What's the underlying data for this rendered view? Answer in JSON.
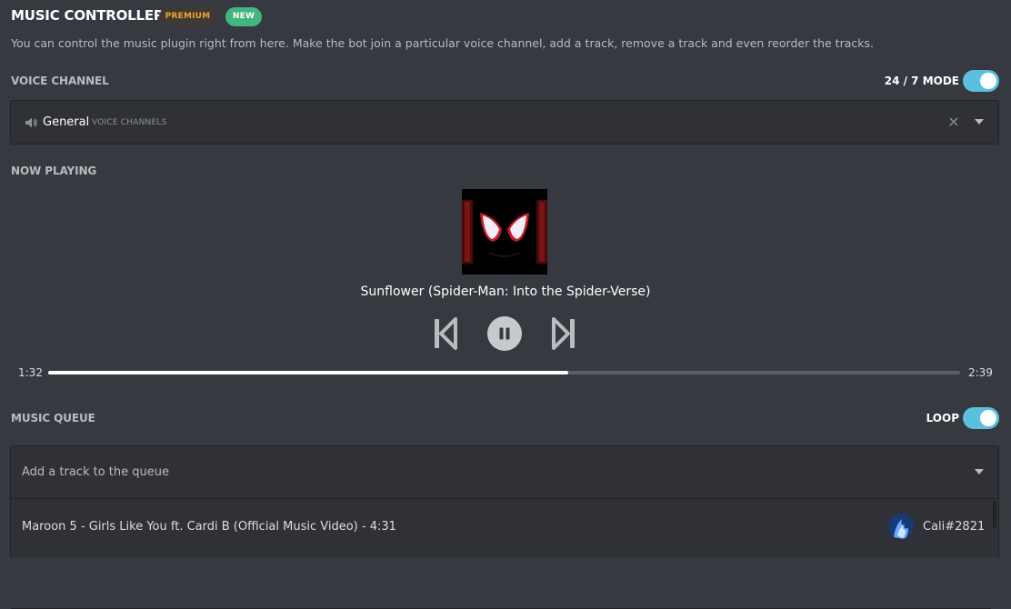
{
  "header": {
    "title": "MUSIC CONTROLLER",
    "badge_premium": "PREMIUM",
    "badge_new": "NEW",
    "description": "You can control the music plugin right from here. Make the bot join a particular voice channel, add a track, remove a track and even reorder the tracks."
  },
  "voice_channel": {
    "label": "VOICE CHANNEL",
    "mode_label": "24 / 7 MODE",
    "mode_enabled": true,
    "selected_name": "General",
    "selected_category": "VOICE CHANNELS"
  },
  "now_playing": {
    "label": "NOW PLAYING",
    "title": "Sunflower (Spider-Man: Into the Spider-Verse)",
    "elapsed": "1:32",
    "duration": "2:39",
    "progress_fraction": 0.57,
    "state": "playing"
  },
  "queue": {
    "label": "MUSIC QUEUE",
    "loop_label": "LOOP",
    "loop_enabled": true,
    "placeholder": "Add a track to the queue",
    "items": [
      {
        "title": "Maroon 5 - Girls Like You ft. Cardi B (Official Music Video) - 4:31",
        "requester": "Cali#2821"
      }
    ]
  },
  "colors": {
    "background": "#36393f",
    "panel": "#2f3136",
    "accent_toggle": "#5bc0de",
    "premium": "#f0a232",
    "new": "#43b581"
  },
  "icons": [
    "speaker-icon",
    "clear-icon",
    "dropdown-caret-icon",
    "previous-track-icon",
    "pause-icon",
    "next-track-icon"
  ]
}
